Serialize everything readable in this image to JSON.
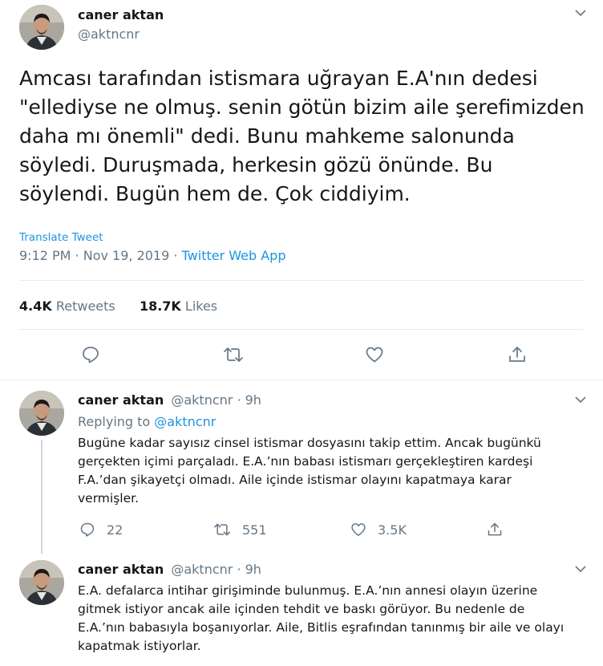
{
  "main_tweet": {
    "author_name": "caner aktan",
    "author_handle": "@aktncnr",
    "text_lines": [
      "Amcası tarafından istismara uğrayan E.A'nın dedesi",
      "\"ellediyse ne olmuş. senin götün bizim aile şerefimizden",
      "daha mı önemli\" dedi. Bunu mahkeme salonunda",
      "söyledi. Duruşmada, herkesin gözü önünde. Bu",
      "söylendi. Bugün hem de. Çok ciddiyim."
    ],
    "translate_label": "Translate Tweet",
    "timestamp": "9:12 PM · Nov 19, 2019 · ",
    "source": "Twitter Web App",
    "retweets_count": "4.4K",
    "retweets_label": "Retweets",
    "likes_count": "18.7K",
    "likes_label": "Likes"
  },
  "replies": [
    {
      "author_name": "caner aktan",
      "author_handle": "@aktncnr · 9h",
      "replying_label": "Replying to ",
      "replying_handle": "@aktncnr",
      "text_lines": [
        "Bugüne kadar sayısız cinsel istismar dosyasını takip ettim. Ancak bugünkü",
        "gerçekten içimi parçaladı. E.A.’nın babası istismarı gerçekleştiren kardeşi",
        "F.A.’dan şikayetçi olmadı. Aile içinde istismar olayını kapatmaya karar",
        "vermişler."
      ],
      "reply_count": "22",
      "retweet_count": "551",
      "like_count": "3.5K"
    },
    {
      "author_name": "caner aktan",
      "author_handle": "@aktncnr · 9h",
      "text_lines": [
        "E.A. defalarca intihar girişiminde bulunmuş. E.A.’nın annesi olayın üzerine",
        "gitmek istiyor ancak aile içinden tehdit ve baskı görüyor. Bu nedenle de",
        "E.A.’nın babasıyla boşanıyorlar. Aile, Bitlis eşrafından tanınmış bir aile ve olayı",
        "kapatmak istiyorlar."
      ]
    }
  ],
  "icons": [
    "chevron-down-icon",
    "reply-icon",
    "retweet-icon",
    "like-icon",
    "share-icon"
  ],
  "colors": {
    "link": "#1b95e0",
    "secondary_text": "#657786",
    "divider": "#e6ecf0"
  }
}
